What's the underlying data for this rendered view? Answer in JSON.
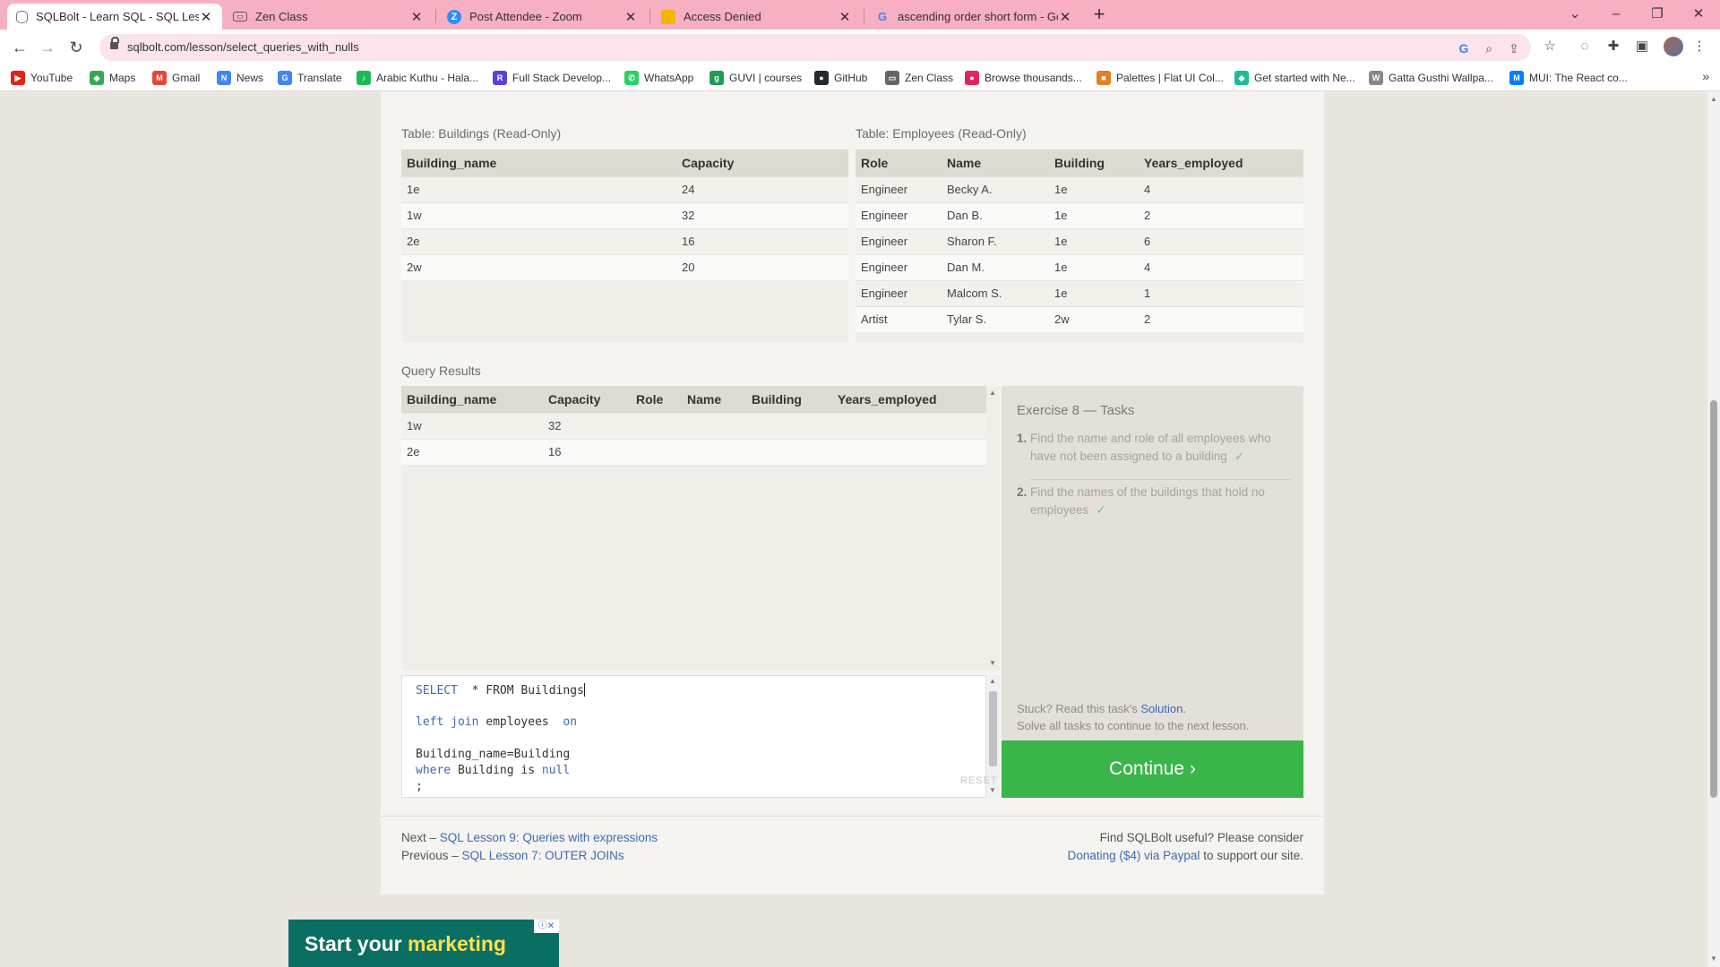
{
  "browser": {
    "tabs": [
      {
        "title": "SQLBolt - Learn SQL - SQL Lesso",
        "icon": "database-icon",
        "active": true
      },
      {
        "title": "Zen Class",
        "icon": "zen-class-icon",
        "active": false
      },
      {
        "title": "Post Attendee - Zoom",
        "icon": "zoom-icon",
        "active": false
      },
      {
        "title": "Access Denied",
        "icon": "slides-icon",
        "active": false
      },
      {
        "title": "ascending order short form - Go",
        "icon": "google-icon",
        "active": false
      }
    ],
    "new_tab_label": "+",
    "url": "sqlbolt.com/lesson/select_queries_with_nulls",
    "bookmarks": [
      {
        "label": "YouTube",
        "color": "#e62117",
        "glyph": "▶"
      },
      {
        "label": "Maps",
        "color": "#34a853",
        "glyph": "◆"
      },
      {
        "label": "Gmail",
        "color": "#ea4335",
        "glyph": "M"
      },
      {
        "label": "News",
        "color": "#4285f4",
        "glyph": "N"
      },
      {
        "label": "Translate",
        "color": "#4285f4",
        "glyph": "G"
      },
      {
        "label": "Arabic Kuthu - Hala...",
        "color": "#1db954",
        "glyph": "♪"
      },
      {
        "label": "Full Stack Develop...",
        "color": "#5b3fd9",
        "glyph": "R"
      },
      {
        "label": "WhatsApp",
        "color": "#25d366",
        "glyph": "✆"
      },
      {
        "label": "GUVI | courses",
        "color": "#1f9d55",
        "glyph": "g"
      },
      {
        "label": "GitHub",
        "color": "#24292e",
        "glyph": "●"
      },
      {
        "label": "Zen Class",
        "color": "#666666",
        "glyph": "▭"
      },
      {
        "label": "Browse thousands...",
        "color": "#e0245e",
        "glyph": "●"
      },
      {
        "label": "Palettes | Flat UI Col...",
        "color": "#e67e22",
        "glyph": "■"
      },
      {
        "label": "Get started with Ne...",
        "color": "#1abc9c",
        "glyph": "◆"
      },
      {
        "label": "Gatta Gusthi Wallpa...",
        "color": "#888888",
        "glyph": "W"
      },
      {
        "label": "MUI: The React co...",
        "color": "#007fff",
        "glyph": "M"
      }
    ]
  },
  "buildings_table": {
    "caption": "Table: Buildings (Read-Only)",
    "columns": [
      "Building_name",
      "Capacity"
    ],
    "rows": [
      [
        "1e",
        "24"
      ],
      [
        "1w",
        "32"
      ],
      [
        "2e",
        "16"
      ],
      [
        "2w",
        "20"
      ]
    ]
  },
  "employees_table": {
    "caption": "Table: Employees (Read-Only)",
    "columns": [
      "Role",
      "Name",
      "Building",
      "Years_employed"
    ],
    "rows": [
      [
        "Engineer",
        "Becky A.",
        "1e",
        "4"
      ],
      [
        "Engineer",
        "Dan B.",
        "1e",
        "2"
      ],
      [
        "Engineer",
        "Sharon F.",
        "1e",
        "6"
      ],
      [
        "Engineer",
        "Dan M.",
        "1e",
        "4"
      ],
      [
        "Engineer",
        "Malcom S.",
        "1e",
        "1"
      ],
      [
        "Artist",
        "Tylar S.",
        "2w",
        "2"
      ]
    ]
  },
  "query_results": {
    "caption": "Query Results",
    "columns": [
      "Building_name",
      "Capacity",
      "Role",
      "Name",
      "Building",
      "Years_employed"
    ],
    "rows": [
      [
        "1w",
        "32",
        "",
        "",
        "",
        ""
      ],
      [
        "2e",
        "16",
        "",
        "",
        "",
        ""
      ]
    ]
  },
  "editor": {
    "lines": [
      {
        "kw1": "SELECT",
        "rest": "  * FROM Buildings"
      },
      {
        "kw1": "left join",
        "mid": " employees  ",
        "kw2": "on"
      },
      {
        "plain": "Building_name=Building"
      },
      {
        "kw1": "where",
        "mid": " Building is ",
        "kw2": "null"
      },
      {
        "plain": ";"
      }
    ],
    "reset_label": "RESET"
  },
  "exercise": {
    "title": "Exercise 8 — Tasks",
    "tasks": [
      {
        "num": "1.",
        "text": "Find the name and role of all employees who have not been assigned to a building",
        "check": "✓"
      },
      {
        "num": "2.",
        "text": "Find the names of the buildings that hold no employees",
        "check": "✓"
      }
    ],
    "stuck_prefix": "Stuck? Read this task's ",
    "stuck_link": "Solution.",
    "stuck_line2": "Solve all tasks to continue to the next lesson.",
    "continue_label": "Continue ›"
  },
  "footer": {
    "next_prefix": "Next – ",
    "next_link": "SQL Lesson 9: Queries with expressions",
    "prev_prefix": "Previous – ",
    "prev_link": "SQL Lesson 7: OUTER JOINs",
    "support_line1": "Find SQLBolt useful? Please consider",
    "donate_link": "Donating ($4) via Paypal",
    "support_suffix": " to support our site."
  },
  "ad": {
    "text_plain": "Start your ",
    "text_highlight": "marketing"
  }
}
